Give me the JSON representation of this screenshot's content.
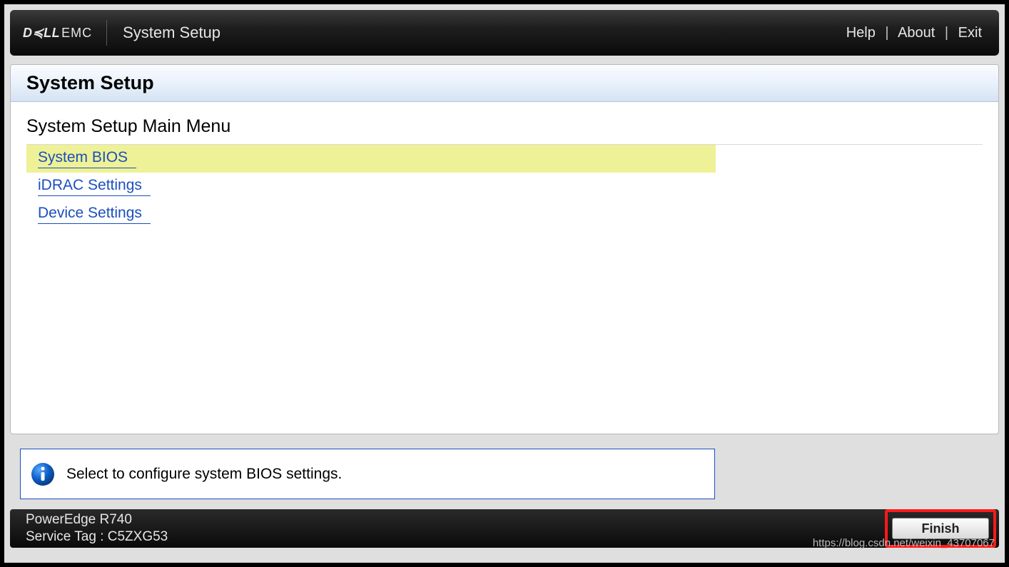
{
  "topbar": {
    "logo_primary": "D≼LL",
    "logo_secondary": "EMC",
    "app_title": "System Setup",
    "links": {
      "help": "Help",
      "about": "About",
      "exit": "Exit"
    }
  },
  "panel": {
    "title": "System Setup",
    "subtitle": "System Setup Main Menu"
  },
  "menu": {
    "items": [
      {
        "label": "System BIOS",
        "selected": true
      },
      {
        "label": "iDRAC Settings",
        "selected": false
      },
      {
        "label": "Device Settings",
        "selected": false
      }
    ]
  },
  "info": {
    "text": "Select to configure system BIOS settings."
  },
  "footer": {
    "model": "PowerEdge R740",
    "service_tag_line": "Service Tag : C5ZXG53",
    "finish_label": "Finish"
  },
  "watermark": "https://blog.csdn.net/weixin_43707067"
}
